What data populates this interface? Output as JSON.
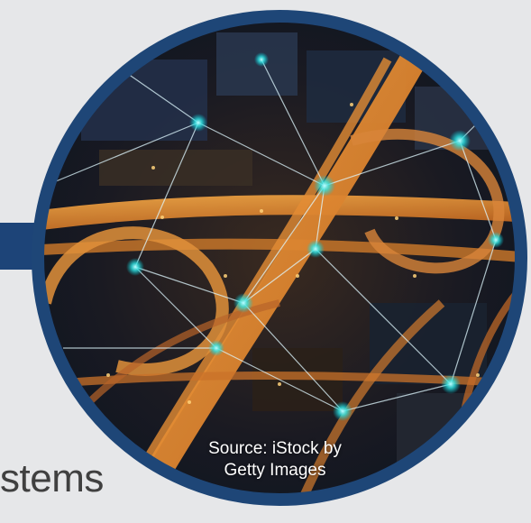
{
  "heading": {
    "partial_text": "stems"
  },
  "photo": {
    "description_icon": "city-interchange-photo",
    "caption_line1": "Source: iStock by",
    "caption_line2": "Getty Images"
  },
  "colors": {
    "background": "#e6e7e9",
    "accent_blue": "#1d4478",
    "ring_blue": "#1e4677",
    "heading_text": "#404040"
  }
}
